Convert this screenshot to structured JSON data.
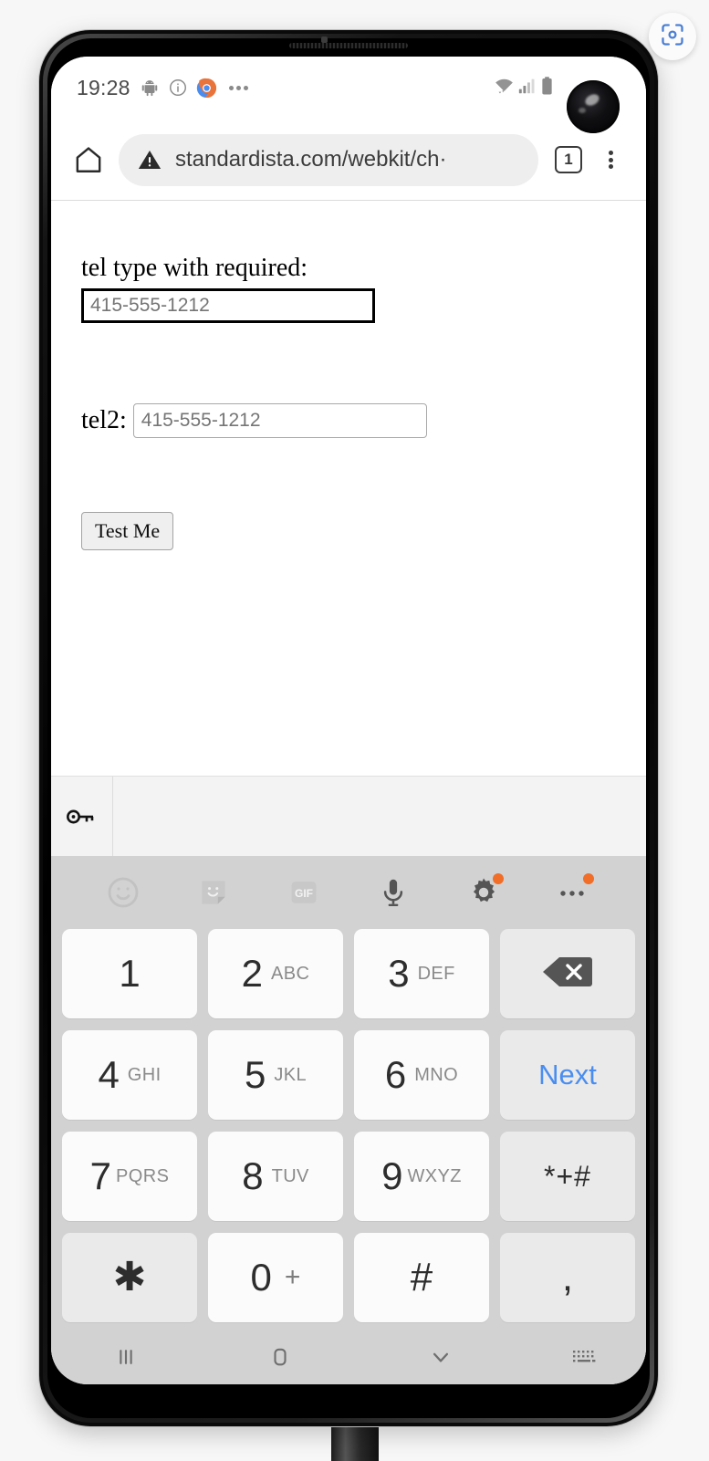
{
  "screenshot_fab": {
    "icon": "screenshot-scan-icon",
    "color": "#4a7fd4"
  },
  "status_bar": {
    "time": "19:28",
    "left_icons": [
      "android-robot-icon",
      "info-circle-icon",
      "chrome-icon",
      "more-notifications-icon"
    ],
    "right_icons": [
      "wifi-icon",
      "cellular-signal-icon",
      "battery-icon"
    ]
  },
  "browser": {
    "home_icon": "home-icon",
    "security_icon": "warning-triangle-icon",
    "url": "standardista.com/webkit/ch·",
    "tab_count": "1",
    "menu_icon": "overflow-menu-icon"
  },
  "page": {
    "tel1_label": "tel type with required:",
    "tel1_placeholder": "415-555-1212",
    "tel1_value": "",
    "tel2_label": "tel2:",
    "tel2_placeholder": "415-555-1212",
    "tel2_value": "",
    "submit_label": "Test Me"
  },
  "autofill": {
    "key_icon": "password-key-icon"
  },
  "keyboard": {
    "toolbar": [
      {
        "name": "emoji-icon",
        "badge": false,
        "dim": true
      },
      {
        "name": "sticker-icon",
        "badge": false,
        "dim": true
      },
      {
        "name": "gif-icon",
        "badge": false,
        "dim": true,
        "label": "GIF"
      },
      {
        "name": "microphone-icon",
        "badge": false,
        "dim": false
      },
      {
        "name": "settings-gear-icon",
        "badge": true,
        "dim": false
      },
      {
        "name": "keyboard-overflow-icon",
        "badge": true,
        "dim": false
      }
    ],
    "badge_color": "#f06e28",
    "next_key_color": "#4a8df0",
    "rows": [
      [
        {
          "main": "1",
          "sub": "",
          "type": "num"
        },
        {
          "main": "2",
          "sub": "ABC",
          "type": "num"
        },
        {
          "main": "3",
          "sub": "DEF",
          "type": "num"
        },
        {
          "main": "",
          "sub": "",
          "type": "backspace",
          "icon": "backspace-icon"
        }
      ],
      [
        {
          "main": "4",
          "sub": "GHI",
          "type": "num"
        },
        {
          "main": "5",
          "sub": "JKL",
          "type": "num"
        },
        {
          "main": "6",
          "sub": "MNO",
          "type": "num"
        },
        {
          "main": "Next",
          "sub": "",
          "type": "next"
        }
      ],
      [
        {
          "main": "7",
          "sub": "PQRS",
          "type": "num"
        },
        {
          "main": "8",
          "sub": "TUV",
          "type": "num"
        },
        {
          "main": "9",
          "sub": "WXYZ",
          "type": "num"
        },
        {
          "main": "*+#",
          "sub": "",
          "type": "sym"
        }
      ],
      [
        {
          "main": "✱",
          "sub": "",
          "type": "star"
        },
        {
          "main": "0",
          "sub": "+",
          "type": "zero"
        },
        {
          "main": "#",
          "sub": "",
          "type": "hash"
        },
        {
          "main": ",",
          "sub": "",
          "type": "comma"
        }
      ]
    ]
  },
  "nav_bar": {
    "recents_icon": "recents-icon",
    "home_icon": "home-square-icon",
    "hide_keyboard_icon": "chevron-down-icon",
    "keyboard_switch_icon": "keyboard-switcher-icon"
  }
}
